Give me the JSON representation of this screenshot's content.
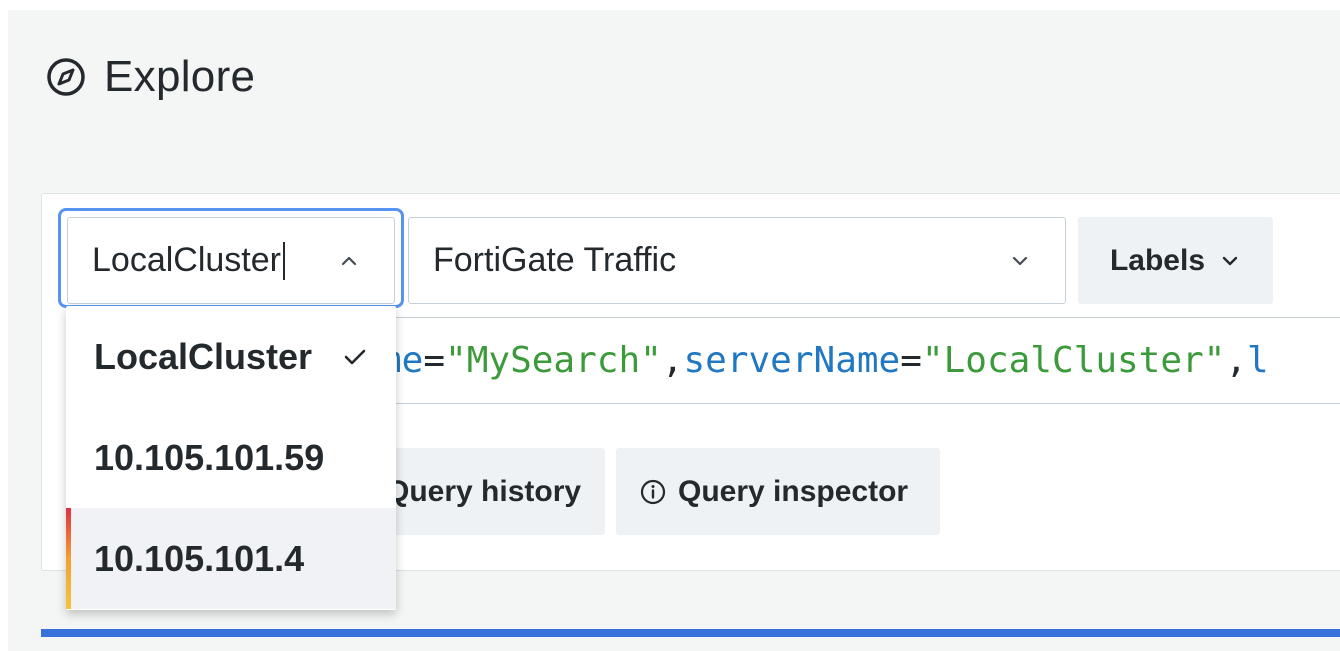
{
  "page": {
    "title": "Explore",
    "icon": "compass-icon"
  },
  "datasource_picker": {
    "value": "LocalCluster",
    "icon": "chevron-up-icon"
  },
  "stream_select": {
    "value": "FortiGate Traffic",
    "icon": "chevron-down-icon"
  },
  "labels_button": {
    "label": "Labels",
    "icon": "chevron-down-icon"
  },
  "query": {
    "tokens": [
      {
        "text": "me",
        "kind": "key"
      },
      {
        "text": "=",
        "kind": "op"
      },
      {
        "text": "\"MySearch\"",
        "kind": "str"
      },
      {
        "text": ",",
        "kind": "op"
      },
      {
        "text": "serverName",
        "kind": "key"
      },
      {
        "text": "=",
        "kind": "op"
      },
      {
        "text": "\"LocalCluster\"",
        "kind": "str"
      },
      {
        "text": ",",
        "kind": "op"
      },
      {
        "text": "l",
        "kind": "key"
      }
    ]
  },
  "actions": {
    "history_label": "Query history",
    "inspector_label": "Query inspector",
    "inspector_icon": "info-circle-icon"
  },
  "dropdown": {
    "items": [
      {
        "label": "LocalCluster",
        "selected": true
      },
      {
        "label": "10.105.101.59",
        "selected": false
      },
      {
        "label": "10.105.101.4",
        "selected": false,
        "hovered": true
      }
    ],
    "check_icon": "check-icon"
  },
  "colors": {
    "accent": "#5794f2",
    "query_key": "#1f78c1",
    "query_string": "#3b9b3b",
    "progress_bar": "#3871dc"
  }
}
